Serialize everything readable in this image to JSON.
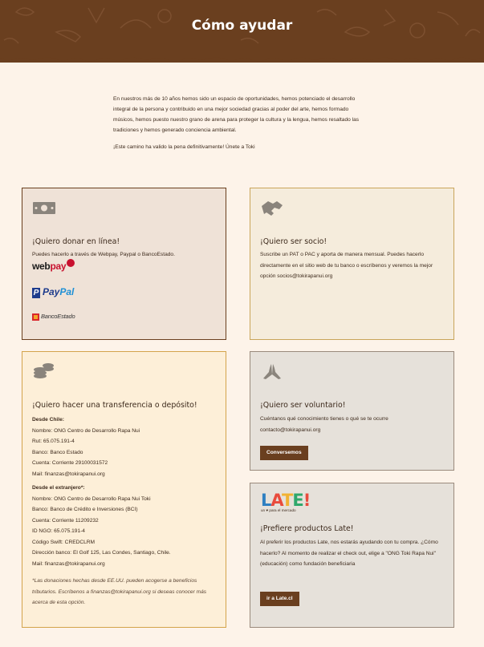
{
  "header": {
    "title": "Cómo ayudar"
  },
  "intro": {
    "paragraph1": "En nuestros más de 10 años hemos sido un espacio de oportunidades, hemos potenciado el desarrollo integral de la persona y contribuido en una mejor sociedad gracias al poder del arte, hemos formado músicos, hemos puesto nuestro grano de arena para proteger la cultura y la lengua, hemos resaltado las tradiciones y hemos generado conciencia ambiental.",
    "paragraph2": "¡Este camino ha valido la pena definitivamente! Únete a Toki"
  },
  "donar": {
    "icon": "money-icon",
    "title": "¡Quiero donar en línea!",
    "text": "Puedes hacerlo a través de Webpay, Paypal o BancoEstado.",
    "webpay": {
      "web": "web",
      "pay": "pay",
      "badge": "plus"
    },
    "paypal": {
      "p": "P",
      "pay": "Pay",
      "pal": "Pal"
    },
    "bancoestado": "BancoEstado"
  },
  "socio": {
    "icon": "handshake-icon",
    "title": "¡Quiero ser socio!",
    "text": "Suscribe un PAT o PAC y aporta de manera mensual. Puedes hacerlo directamente en el sitio web de tu banco o escríbenos y veremos la mejor opción socios@tokirapanui.org"
  },
  "transferencia": {
    "icon": "coins-icon",
    "title": "¡Quiero hacer una transferencia o depósito!",
    "chile_heading": "Desde Chile:",
    "chile_lines": [
      "Nombre: ONG Centro de Desarrollo Rapa Nui",
      "Rut: 65.075.191-4",
      "Banco: Banco Estado",
      "Cuenta: Corriente 29100031572",
      "Mail: finanzas@tokirapanui.org"
    ],
    "ext_heading": "Desde el extranjero*:",
    "ext_lines": [
      "Nombre: ONG Centro de Desarrollo Rapa Nui Toki",
      "Banco: Banco de Crédito e Inversiones (BCI)",
      "Cuenta: Corriente 11209232",
      "ID NGO: 65.075.191-4",
      "Código Swift: CREDCLRM",
      "Dirección banco: El Golf 125, Las Condes, Santiago, Chile.",
      "Mail: finanzas@tokirapanui.org"
    ],
    "note": "*Las donaciones hechas desde EE.UU. pueden acogerse a beneficios tributarios. Escríbenos a finanzas@tokirapanui.org si deseas conocer más acerca de esta opción."
  },
  "voluntario": {
    "icon": "praying-hands-icon",
    "title": "¡Quiero ser voluntario!",
    "text": "Cuéntanos qué conocimiento tienes o qué se te ocurre contacto@tokirapanui.org",
    "button": "Conversemos"
  },
  "late": {
    "logo_letters": [
      "L",
      "A",
      "T",
      "E",
      "!"
    ],
    "logo_colors": [
      "#2e7fc1",
      "#e94b3c",
      "#f2b233",
      "#2fa86b",
      "#e94b3c"
    ],
    "logo_tagline": "un ♥ para el mercado",
    "title": "¡Prefiere productos Late!",
    "text": "Al preferir los productos Late, nos estarás ayudando con tu compra. ¿Cómo hacerlo? Al momento de realizar el check out, elige a \"ONG Toki Rapa Nui\" (educación) como fundación beneficiaria",
    "button": "ir a Late.cl"
  },
  "colors": {
    "brand_brown": "#6a3f1f",
    "background": "#fdf3e9",
    "icon_grey": "#8a847c"
  }
}
